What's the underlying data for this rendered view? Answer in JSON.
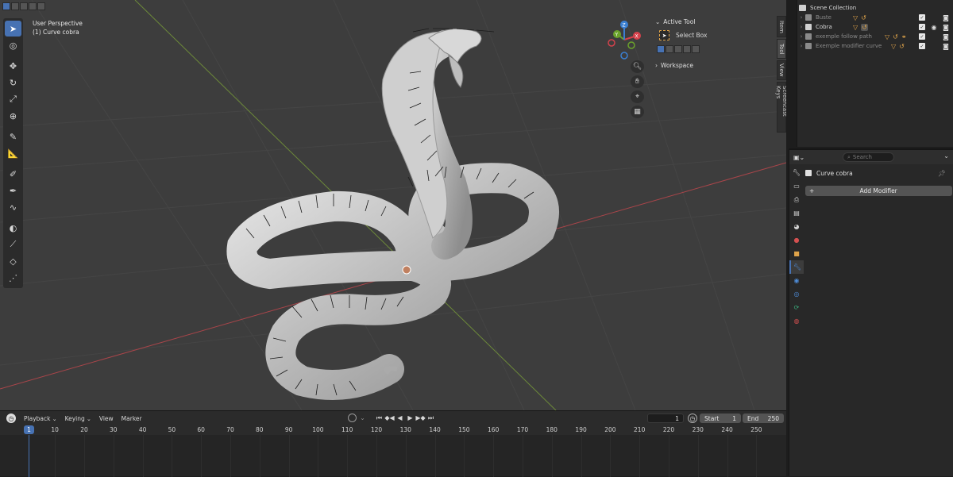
{
  "viewport": {
    "view_name": "User Perspective",
    "object_label": "(1) Curve cobra",
    "active_tool": {
      "header": "Active Tool",
      "tool_name": "Select Box"
    },
    "workspace_header": "Workspace",
    "gizmo": {
      "axis_x": "X",
      "axis_y": "Y",
      "axis_z": "Z"
    },
    "npanel_tabs": [
      "Item",
      "Tool",
      "View",
      "Screencast Keys"
    ],
    "toolbar_icons": [
      "select-box",
      "cursor",
      "move",
      "rotate",
      "scale",
      "transform",
      "annotate",
      "measure",
      "draw",
      "pen",
      "curve",
      "radius",
      "tilt",
      "extrude",
      "randomize",
      "polyline"
    ]
  },
  "timeline": {
    "menu": {
      "playback": "Playback",
      "keying": "Keying",
      "view": "View",
      "marker": "Marker"
    },
    "current_frame": "1",
    "start_label": "Start",
    "start_value": "1",
    "end_label": "End",
    "end_value": "250",
    "playhead_frame": "1",
    "ruler_ticks": [
      "10",
      "20",
      "30",
      "40",
      "50",
      "60",
      "70",
      "80",
      "90",
      "100",
      "110",
      "120",
      "130",
      "140",
      "150",
      "160",
      "170",
      "180",
      "190",
      "200",
      "210",
      "220",
      "230",
      "240",
      "250"
    ]
  },
  "outliner": {
    "root": "Scene Collection",
    "items": [
      {
        "name": "Buste",
        "dim": true
      },
      {
        "name": "Cobra",
        "dim": false
      },
      {
        "name": "exemple follow path",
        "dim": true
      },
      {
        "name": "Exemple modifier curve",
        "dim": true
      }
    ]
  },
  "properties": {
    "search_placeholder": "Search",
    "object_name": "Curve cobra",
    "add_modifier_label": "Add Modifier"
  },
  "colors": {
    "accent": "#4772b3",
    "viewport_bg": "#3d3d3d",
    "modifier_orange": "#e0a44a",
    "axis_x": "#d4424c",
    "axis_y": "#6ba22b",
    "axis_z": "#3b7fd1"
  }
}
